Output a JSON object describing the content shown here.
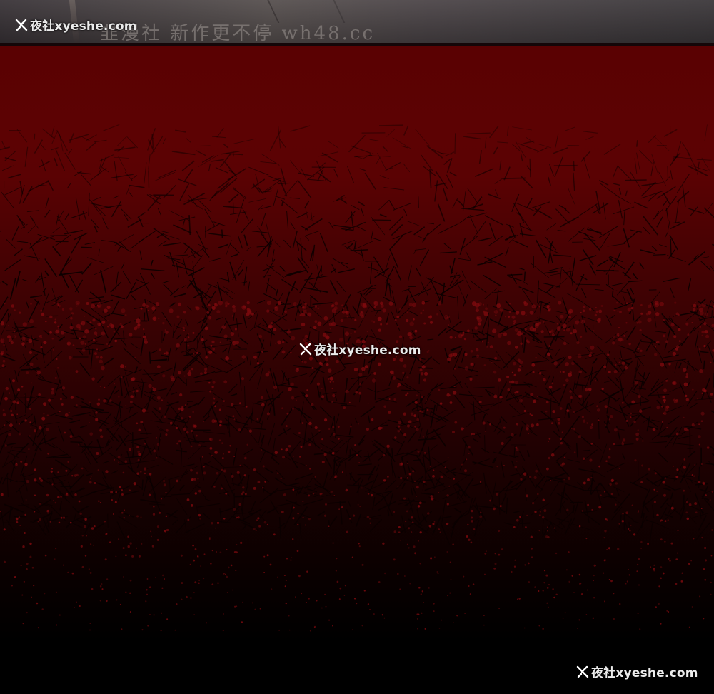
{
  "watermark": {
    "label": "夜社xyeshe.com",
    "icon": "x-logo-icon"
  },
  "promo_text": "韭漫社 新作更不停 wh48.cc",
  "colors": {
    "blood_red": "#5a0102",
    "crack_red": "#8a0a10",
    "shadow": "#000000",
    "strip_gray": "#57504f"
  }
}
